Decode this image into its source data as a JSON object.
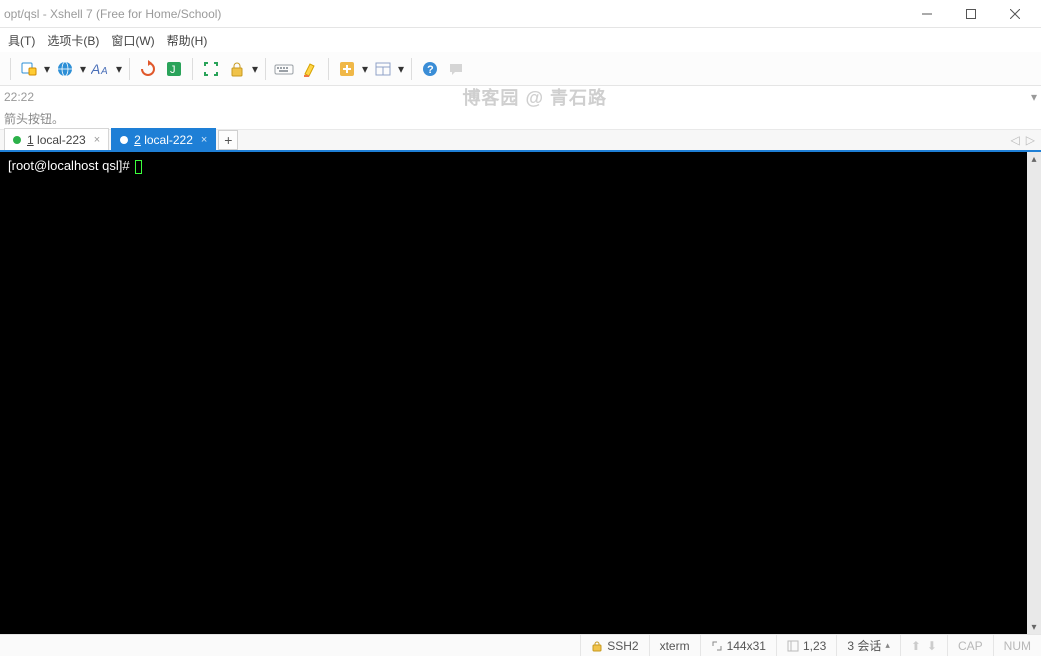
{
  "title": "opt/qsl - Xshell 7 (Free for Home/School)",
  "menu": {
    "tool": "具(T)",
    "tab": "选项卡(B)",
    "window": "窗口(W)",
    "help": "帮助(H)"
  },
  "address": {
    "text": "22:22",
    "dropdown": "▾"
  },
  "hint": "箭头按钮。",
  "watermark": "博客园 @ 青石路",
  "tabs": [
    {
      "num": "1",
      "label": "local-223",
      "active": false
    },
    {
      "num": "2",
      "label": "local-222",
      "active": true
    }
  ],
  "tabadd": "+",
  "terminal": {
    "prompt": "[root@localhost qsl]# "
  },
  "status": {
    "ssh": "SSH2",
    "term": "xterm",
    "size": "144x31",
    "pos": "1,23",
    "sess": "3 会话",
    "cap": "CAP",
    "num": "NUM"
  },
  "toolbar_icons": {
    "dropdown_cue": "▾"
  },
  "tabnav": {
    "prev": "◁",
    "next": "▷"
  }
}
